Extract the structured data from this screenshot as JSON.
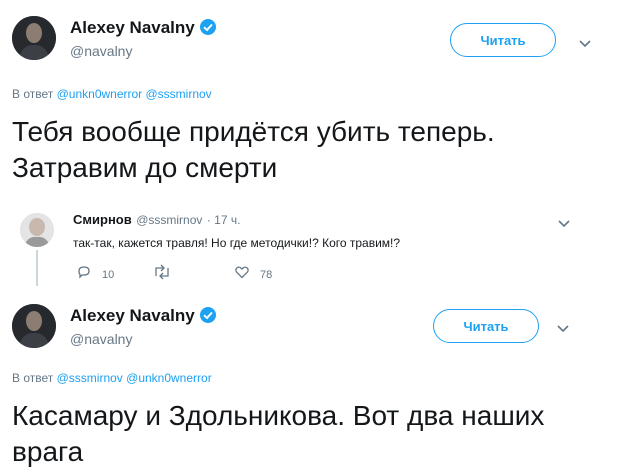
{
  "tweet1": {
    "name": "Alexey Navalny",
    "handle": "@navalny",
    "follow_label": "Читать",
    "reply_prefix": "В ответ",
    "reply_mentions": "@unkn0wnerror @sssmirnov",
    "text_line1": "Тебя вообще придётся убить теперь.",
    "text_line2": "Затравим до смерти"
  },
  "reply": {
    "name": "Смирнов",
    "handle": "@sssmirnov",
    "time": "· 17 ч.",
    "text": "так-так, кажется травля! Но где методички!? Кого травим!?",
    "replies": "10",
    "likes": "78"
  },
  "tweet2": {
    "name": "Alexey Navalny",
    "handle": "@navalny",
    "follow_label": "Читать",
    "reply_prefix": "В ответ",
    "reply_mentions": "@sssmirnov @unkn0wnerror",
    "text_line1": "Касамару и Здольникова. Вот два наших",
    "text_line2": "врага"
  },
  "colors": {
    "accent": "#1da1f2",
    "muted": "#657786",
    "text": "#14171a"
  },
  "icons": [
    "verified-icon",
    "chevron-down-icon",
    "reply-icon",
    "retweet-icon",
    "like-icon"
  ]
}
